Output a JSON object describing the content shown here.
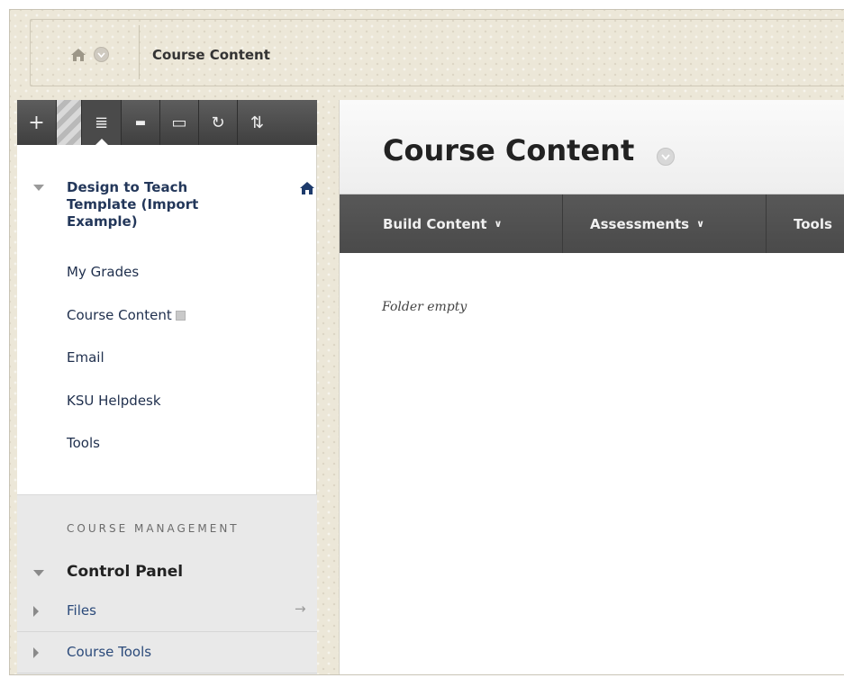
{
  "breadcrumb": {
    "label": "Course Content"
  },
  "toolbar": {
    "buttons": [
      {
        "icon": "add-icon",
        "glyph": "+"
      },
      {
        "icon": "list-view-icon",
        "glyph": "≣"
      },
      {
        "icon": "folder-icon",
        "glyph": "▬"
      },
      {
        "icon": "window-icon",
        "glyph": "▭"
      },
      {
        "icon": "refresh-icon",
        "glyph": "↻"
      },
      {
        "icon": "sort-icon",
        "glyph": "⇅"
      }
    ]
  },
  "course": {
    "title": "Design to Teach Template (Import Example)"
  },
  "menu": {
    "items": [
      {
        "label": "My Grades"
      },
      {
        "label": "Course Content"
      },
      {
        "label": "Email"
      },
      {
        "label": "KSU Helpdesk"
      },
      {
        "label": "Tools"
      }
    ]
  },
  "management": {
    "heading": "COURSE MANAGEMENT",
    "control_panel": "Control Panel",
    "rows": [
      {
        "label": "Files",
        "arrow": "→"
      },
      {
        "label": "Course Tools"
      }
    ]
  },
  "content": {
    "title": "Course Content",
    "actions": [
      {
        "label": "Build Content",
        "chevron": "∨"
      },
      {
        "label": "Assessments",
        "chevron": "∨"
      },
      {
        "label": "Tools"
      }
    ],
    "empty_message": "Folder empty"
  }
}
